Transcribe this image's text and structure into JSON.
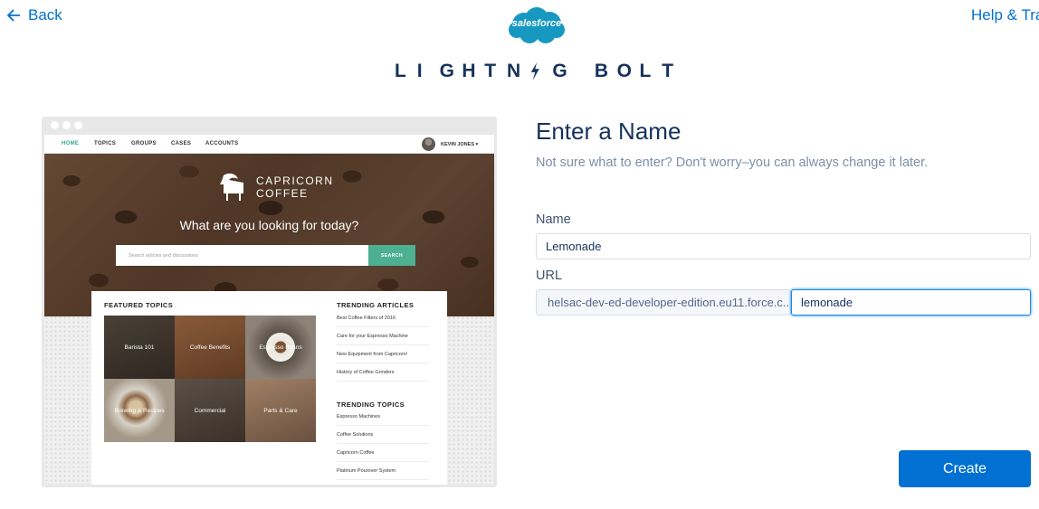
{
  "header": {
    "back_label": "Back",
    "help_label": "Help & Trai",
    "logo_text": "salesforce",
    "title_letters": [
      "L",
      "I",
      "G",
      "H",
      "T",
      "N",
      "G",
      "B",
      "O",
      "L",
      "T"
    ]
  },
  "preview": {
    "nav": [
      "HOME",
      "TOPICS",
      "GROUPS",
      "CASES",
      "ACCOUNTS"
    ],
    "user": "KEVIN JONES ▾",
    "brand_line1": "CAPRICORN",
    "brand_line2": "COFFEE",
    "question": "What are you looking for today?",
    "search_placeholder": "Search articles and discussions",
    "search_button": "SEARCH",
    "featured_title": "FEATURED TOPICS",
    "tiles": [
      "Barista 101",
      "Coffee Benefits",
      "Espresso Beans",
      "Brewing & Recipes",
      "Commercial",
      "Parts & Care"
    ],
    "trending_articles_title": "TRENDING ARTICLES",
    "trending_articles": [
      "Best Coffee Filters of 2016",
      "Care for your Espresso Machine",
      "New Equipment from Capricorn!",
      "History of Coffee Grinders"
    ],
    "trending_topics_title": "TRENDING TOPICS",
    "trending_topics": [
      "Espresso Machines",
      "Coffee Solutions",
      "Capricorn Coffee",
      "Platinum Pourover System"
    ]
  },
  "form": {
    "title": "Enter a Name",
    "subtitle": "Not sure what to enter? Don't worry–you can always change it later.",
    "name_label": "Name",
    "name_value": "Lemonade",
    "url_label": "URL",
    "url_prefix": "helsac-dev-ed-developer-edition.eu11.force.c...",
    "url_value": "lemonade",
    "create_label": "Create"
  },
  "colors": {
    "accent": "#0070d2",
    "navy": "#16325c",
    "teal": "#4db090"
  }
}
